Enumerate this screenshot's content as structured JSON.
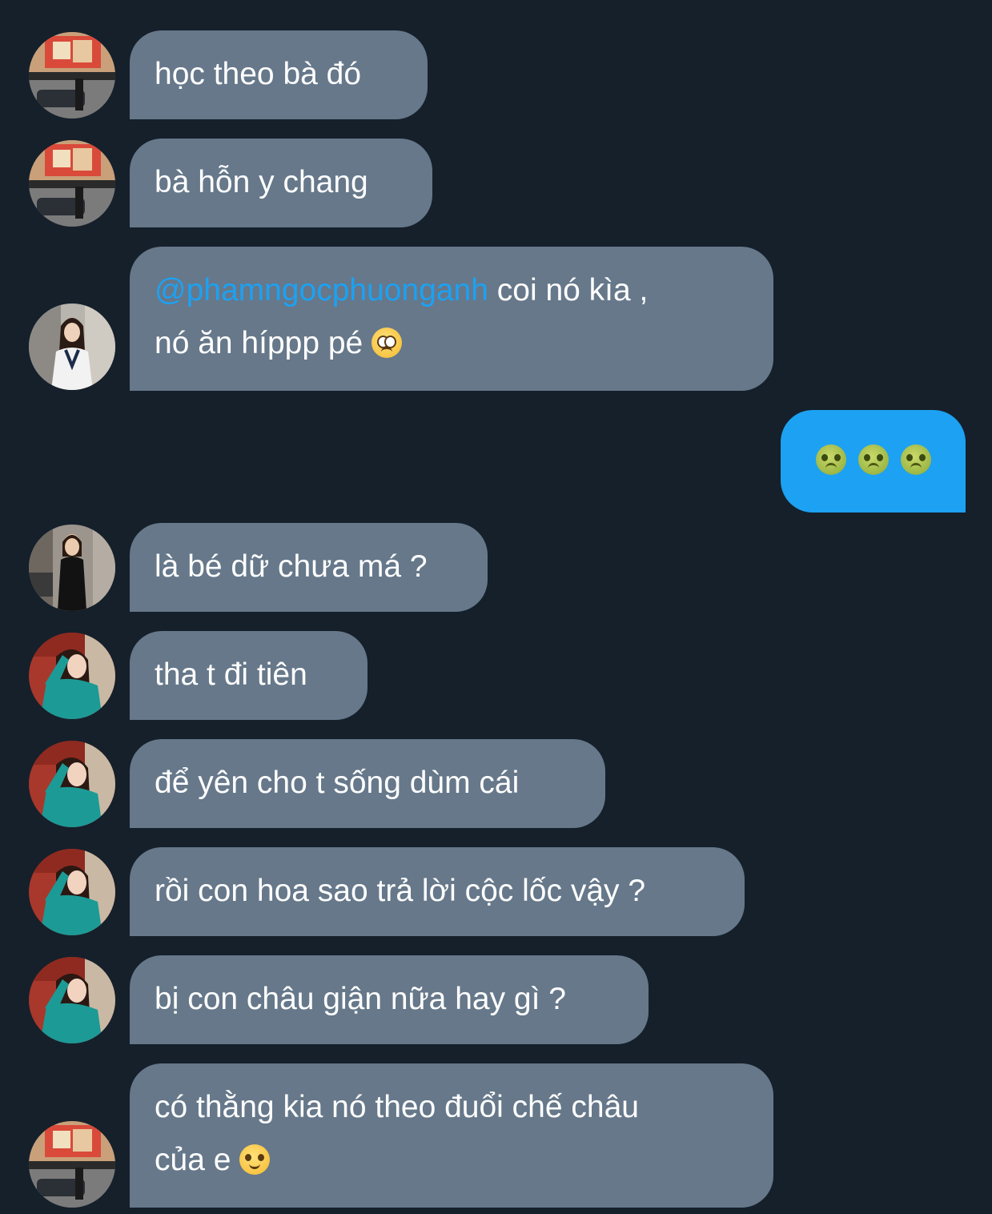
{
  "colors": {
    "background": "#15202b",
    "incoming_bubble": "#66788a",
    "outgoing_bubble": "#1da1f2",
    "mention": "#1da1f2",
    "text": "#ffffff"
  },
  "messages": [
    {
      "direction": "incoming",
      "avatar": "avatar-street-photo",
      "text": "học theo bà đó"
    },
    {
      "direction": "incoming",
      "avatar": "avatar-street-photo",
      "text": "bà hỗn y chang"
    },
    {
      "direction": "incoming",
      "avatar": "avatar-girl-sweater",
      "mention": "@phamngocphuonganh",
      "line1": " coi nó kìa ,",
      "line2": "nó ăn híppp pé",
      "emoji": "pleading-face-icon"
    },
    {
      "direction": "outgoing",
      "emojis": [
        "nauseated-face-icon",
        "nauseated-face-icon",
        "nauseated-face-icon"
      ]
    },
    {
      "direction": "incoming",
      "avatar": "avatar-girl-black-outfit",
      "text": "là bé dữ chưa má ?"
    },
    {
      "direction": "incoming",
      "avatar": "avatar-girl-teal-dress",
      "text": "tha t đi tiên"
    },
    {
      "direction": "incoming",
      "avatar": "avatar-girl-teal-dress",
      "text": "để yên cho t sống dùm cái"
    },
    {
      "direction": "incoming",
      "avatar": "avatar-girl-teal-dress",
      "text": "rồi con hoa sao trả lời cộc lốc vậy ?"
    },
    {
      "direction": "incoming",
      "avatar": "avatar-girl-teal-dress",
      "text": "bị con châu giận nữa hay gì ?"
    },
    {
      "direction": "incoming",
      "avatar": "avatar-street-photo",
      "line1": "có thằng kia nó theo đuổi chế châu",
      "line2": "của e",
      "emoji": "slightly-smiling-face-icon"
    }
  ]
}
